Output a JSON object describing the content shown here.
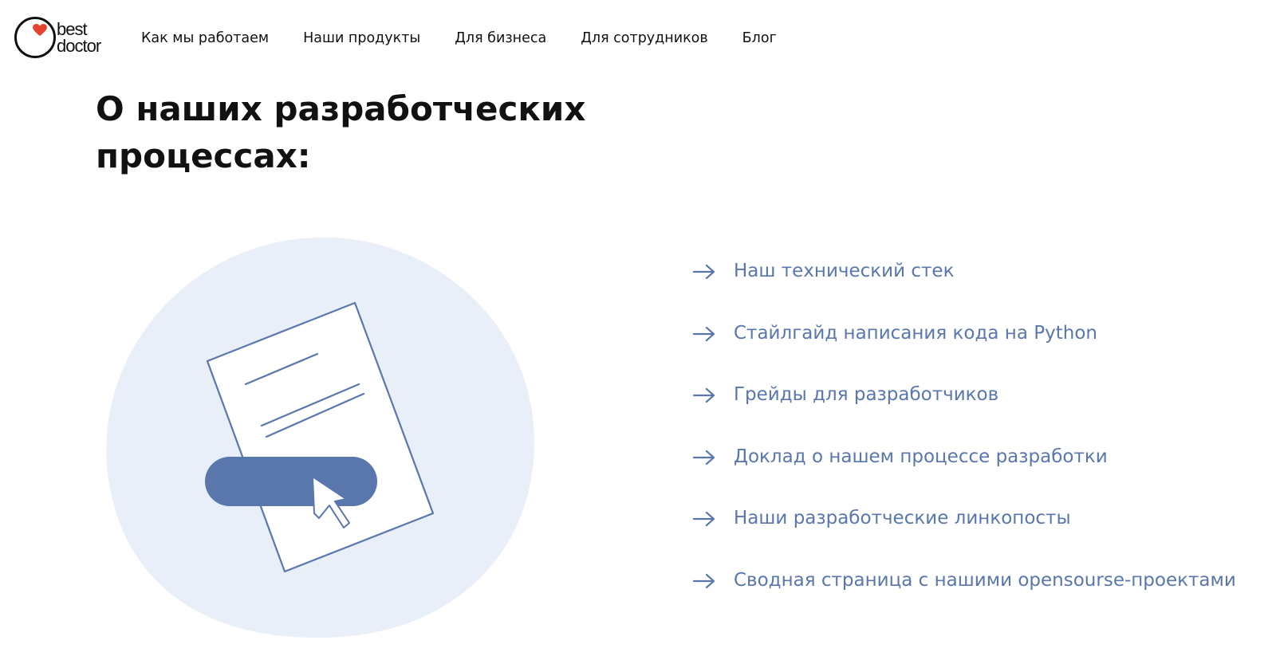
{
  "header": {
    "logo": {
      "line1": "best",
      "line2": "doctor"
    },
    "nav": [
      {
        "label": "Как мы работаем"
      },
      {
        "label": "Наши продукты"
      },
      {
        "label": "Для бизнеса"
      },
      {
        "label": "Для сотрудников"
      },
      {
        "label": "Блог"
      }
    ]
  },
  "main": {
    "title": "О наших разработческих процессах:",
    "links": [
      {
        "label": "Наш технический стек"
      },
      {
        "label": "Стайлгайд написания кода на Python"
      },
      {
        "label": "Грейды для разработчиков"
      },
      {
        "label": "Доклад о нашем процессе разработки"
      },
      {
        "label": "Наши разработческие линкопосты"
      },
      {
        "label": "Сводная страница с нашими opensourse-проектами"
      }
    ]
  },
  "colors": {
    "text": "#111111",
    "link": "#5977ad",
    "blob": "#e9eff8",
    "button": "#5977ad",
    "heart": "#e4432d"
  }
}
